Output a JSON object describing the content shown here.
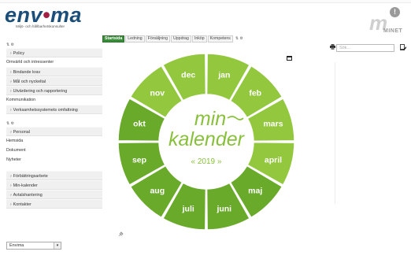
{
  "header": {
    "logo_text": "enviroma",
    "logo_main": "env",
    "logo_dot": "•",
    "logo_end": "ma",
    "logo_subtitle": "Miljö- och hållbarhetskonsulter",
    "minet_letter": "m",
    "minet_badge": "!",
    "minet_word": "MINET"
  },
  "tabs": [
    {
      "label": "Startsida",
      "active": true
    },
    {
      "label": "Ledning",
      "active": false
    },
    {
      "label": "Försäljning",
      "active": false
    },
    {
      "label": "Uppdrag",
      "active": false
    },
    {
      "label": "Inköp",
      "active": false
    },
    {
      "label": "Kompetens",
      "active": false
    }
  ],
  "sidebar": {
    "group1": [
      {
        "label": "Policy",
        "type": "item"
      },
      {
        "label": "Omvärld och intressenter",
        "type": "plain"
      },
      {
        "label": "Bindande krav",
        "type": "item"
      },
      {
        "label": "Mål och nyckeltal",
        "type": "item"
      },
      {
        "label": "Utvärdering och rapportering",
        "type": "item"
      },
      {
        "label": "Kommunikation",
        "type": "plain"
      },
      {
        "label": "Verksamhetssystemets omfattning",
        "type": "item"
      }
    ],
    "group2": [
      {
        "label": "Personal",
        "type": "item"
      },
      {
        "label": "Hemsida",
        "type": "plain"
      },
      {
        "label": "Dokument",
        "type": "plain"
      },
      {
        "label": "Nyheter",
        "type": "plain"
      }
    ],
    "group3": [
      {
        "label": "Förbättringsarbete",
        "type": "item"
      },
      {
        "label": "Min-kalender",
        "type": "item"
      },
      {
        "label": "Avtalshantering",
        "type": "item"
      },
      {
        "label": "Kontakter",
        "type": "item"
      }
    ],
    "select_value": "Envima"
  },
  "search": {
    "placeholder": "Sök..."
  },
  "calendar": {
    "title_top": "min",
    "title_bottom": "kalender",
    "year": "« 2019 »",
    "months": [
      "jan",
      "feb",
      "mars",
      "april",
      "maj",
      "juni",
      "juli",
      "aug",
      "sep",
      "okt",
      "nov",
      "dec"
    ]
  },
  "colors": {
    "green_dark": "#6aaa2a",
    "green_light": "#93c83e",
    "brand_blue": "#1c4e7a",
    "brand_red": "#a21e43",
    "tab_active": "#3a8b3a"
  }
}
